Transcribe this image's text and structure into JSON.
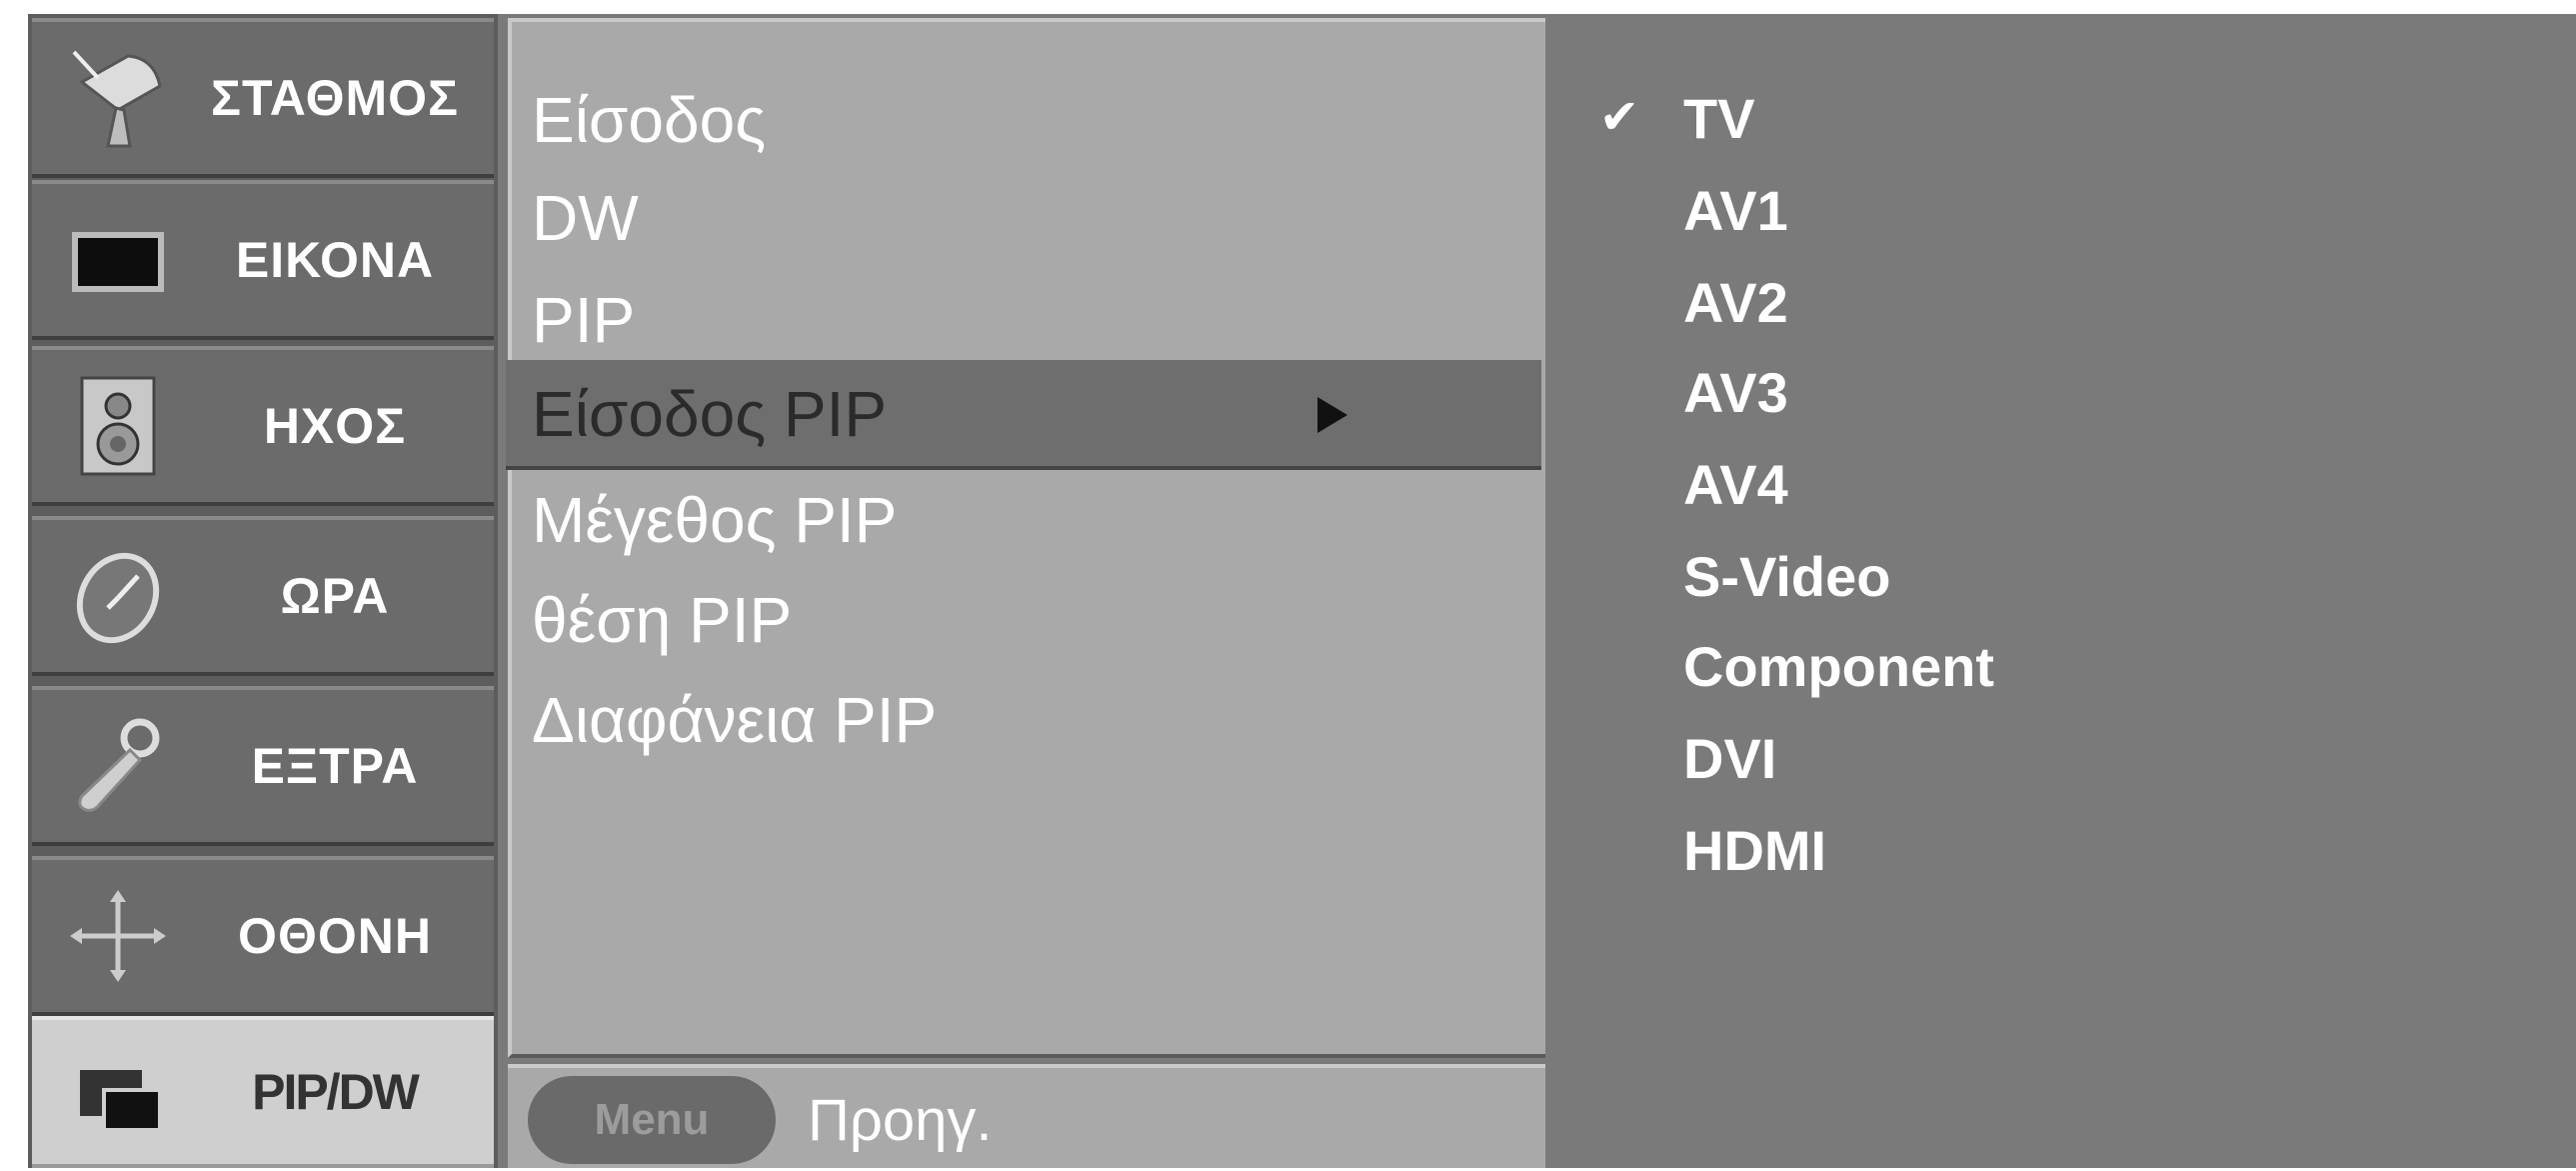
{
  "sidebar": {
    "items": [
      {
        "label": "ΣΤΑΘΜΟΣ",
        "icon": "satellite-dish-icon"
      },
      {
        "label": "ΕΙΚΟΝΑ",
        "icon": "picture-icon"
      },
      {
        "label": "ΗΧΟΣ",
        "icon": "speaker-icon"
      },
      {
        "label": "ΩΡΑ",
        "icon": "clock-icon"
      },
      {
        "label": "ΕΞΤΡΑ",
        "icon": "tools-icon"
      },
      {
        "label": "ΟΘΟΝΗ",
        "icon": "screen-adjust-icon"
      },
      {
        "label": "PIP/DW",
        "icon": "pip-icon",
        "active": true
      }
    ]
  },
  "submenu": {
    "items": [
      {
        "label": "Είσοδος"
      },
      {
        "label": "DW"
      },
      {
        "label": "PIP"
      },
      {
        "label": "Είσοδος PIP",
        "selected": true
      },
      {
        "label": "Μέγεθος PIP"
      },
      {
        "label": "θέση PIP"
      },
      {
        "label": "Διαφάνεια PIP"
      }
    ]
  },
  "bottom": {
    "menu_button": "Menu",
    "back_label": "Προηγ."
  },
  "options": {
    "checked": "TV",
    "items": [
      "TV",
      "AV1",
      "AV2",
      "AV3",
      "AV4",
      "S-Video",
      "Component",
      "DVI",
      "HDMI"
    ]
  },
  "colors": {
    "panel": "#7a7a7a",
    "submenu": "#a9a9a9",
    "highlight": "#6e6e6e",
    "active_tab": "#cfcfcf"
  }
}
